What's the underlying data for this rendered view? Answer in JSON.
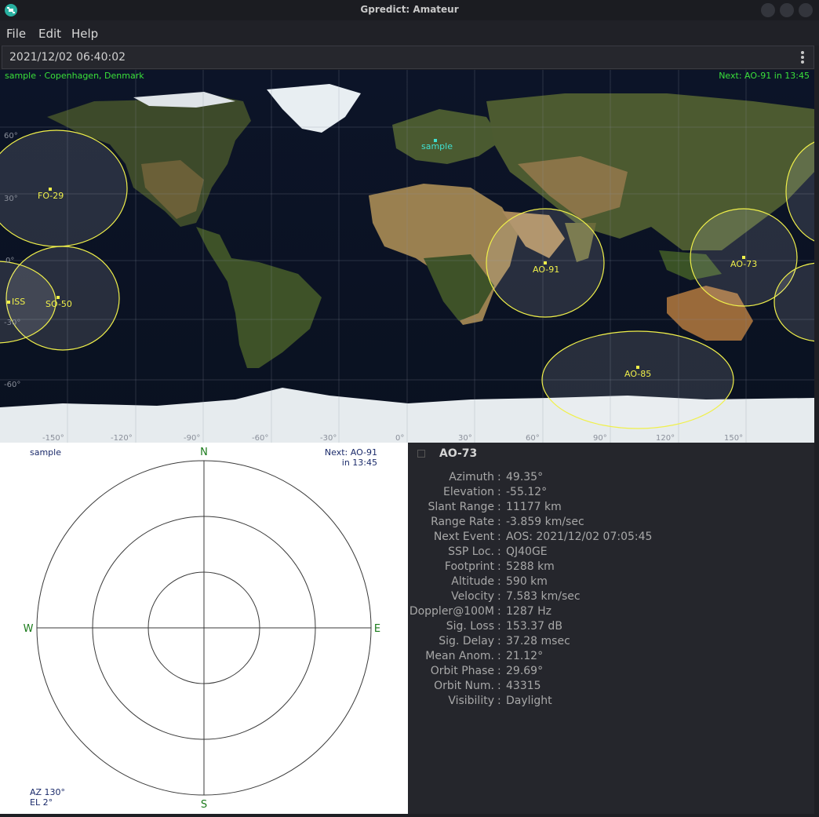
{
  "window": {
    "title": "Gpredict: Amateur"
  },
  "menu": [
    "File",
    "Edit",
    "Help"
  ],
  "time": "2021/12/02 06:40:02",
  "map": {
    "qth_label": "sample · Copenhagen, Denmark",
    "next_event": "Next: AO-91 in 13:45",
    "station_name": "sample",
    "satellites": [
      "FO-29",
      "ISS",
      "SO-50",
      "AO-91",
      "AO-73",
      "AO-85"
    ],
    "lat_labels": [
      "60°",
      "30°",
      "0°",
      "-30°",
      "-60°"
    ],
    "lon_labels": [
      "-150°",
      "-120°",
      "-90°",
      "-60°",
      "-30°",
      "0°",
      "30°",
      "60°",
      "90°",
      "120°",
      "150°"
    ]
  },
  "polar": {
    "qth": "sample",
    "next_line1": "Next: AO-91",
    "next_line2": "in 13:45",
    "dir_n": "N",
    "dir_s": "S",
    "dir_e": "E",
    "dir_w": "W",
    "az": "AZ 130°",
    "el": "EL 2°"
  },
  "details": {
    "satellite": "AO-73",
    "rows": [
      {
        "label": "Azimuth",
        "value": "49.35°"
      },
      {
        "label": "Elevation",
        "value": "-55.12°"
      },
      {
        "label": "Slant Range",
        "value": "11177 km"
      },
      {
        "label": "Range Rate",
        "value": "-3.859 km/sec"
      },
      {
        "label": "Next Event",
        "value": "AOS: 2021/12/02 07:05:45"
      },
      {
        "label": "SSP Loc.",
        "value": "QJ40GE"
      },
      {
        "label": "Footprint",
        "value": "5288 km"
      },
      {
        "label": "Altitude",
        "value": "590 km"
      },
      {
        "label": "Velocity",
        "value": "7.583 km/sec"
      },
      {
        "label": "Doppler@100M",
        "value": "1287 Hz"
      },
      {
        "label": "Sig. Loss",
        "value": "153.37 dB"
      },
      {
        "label": "Sig. Delay",
        "value": "37.28 msec"
      },
      {
        "label": "Mean Anom.",
        "value": "21.12°"
      },
      {
        "label": "Orbit Phase",
        "value": "29.69°"
      },
      {
        "label": "Orbit Num.",
        "value": "43315"
      },
      {
        "label": "Visibility",
        "value": "Daylight"
      }
    ]
  }
}
